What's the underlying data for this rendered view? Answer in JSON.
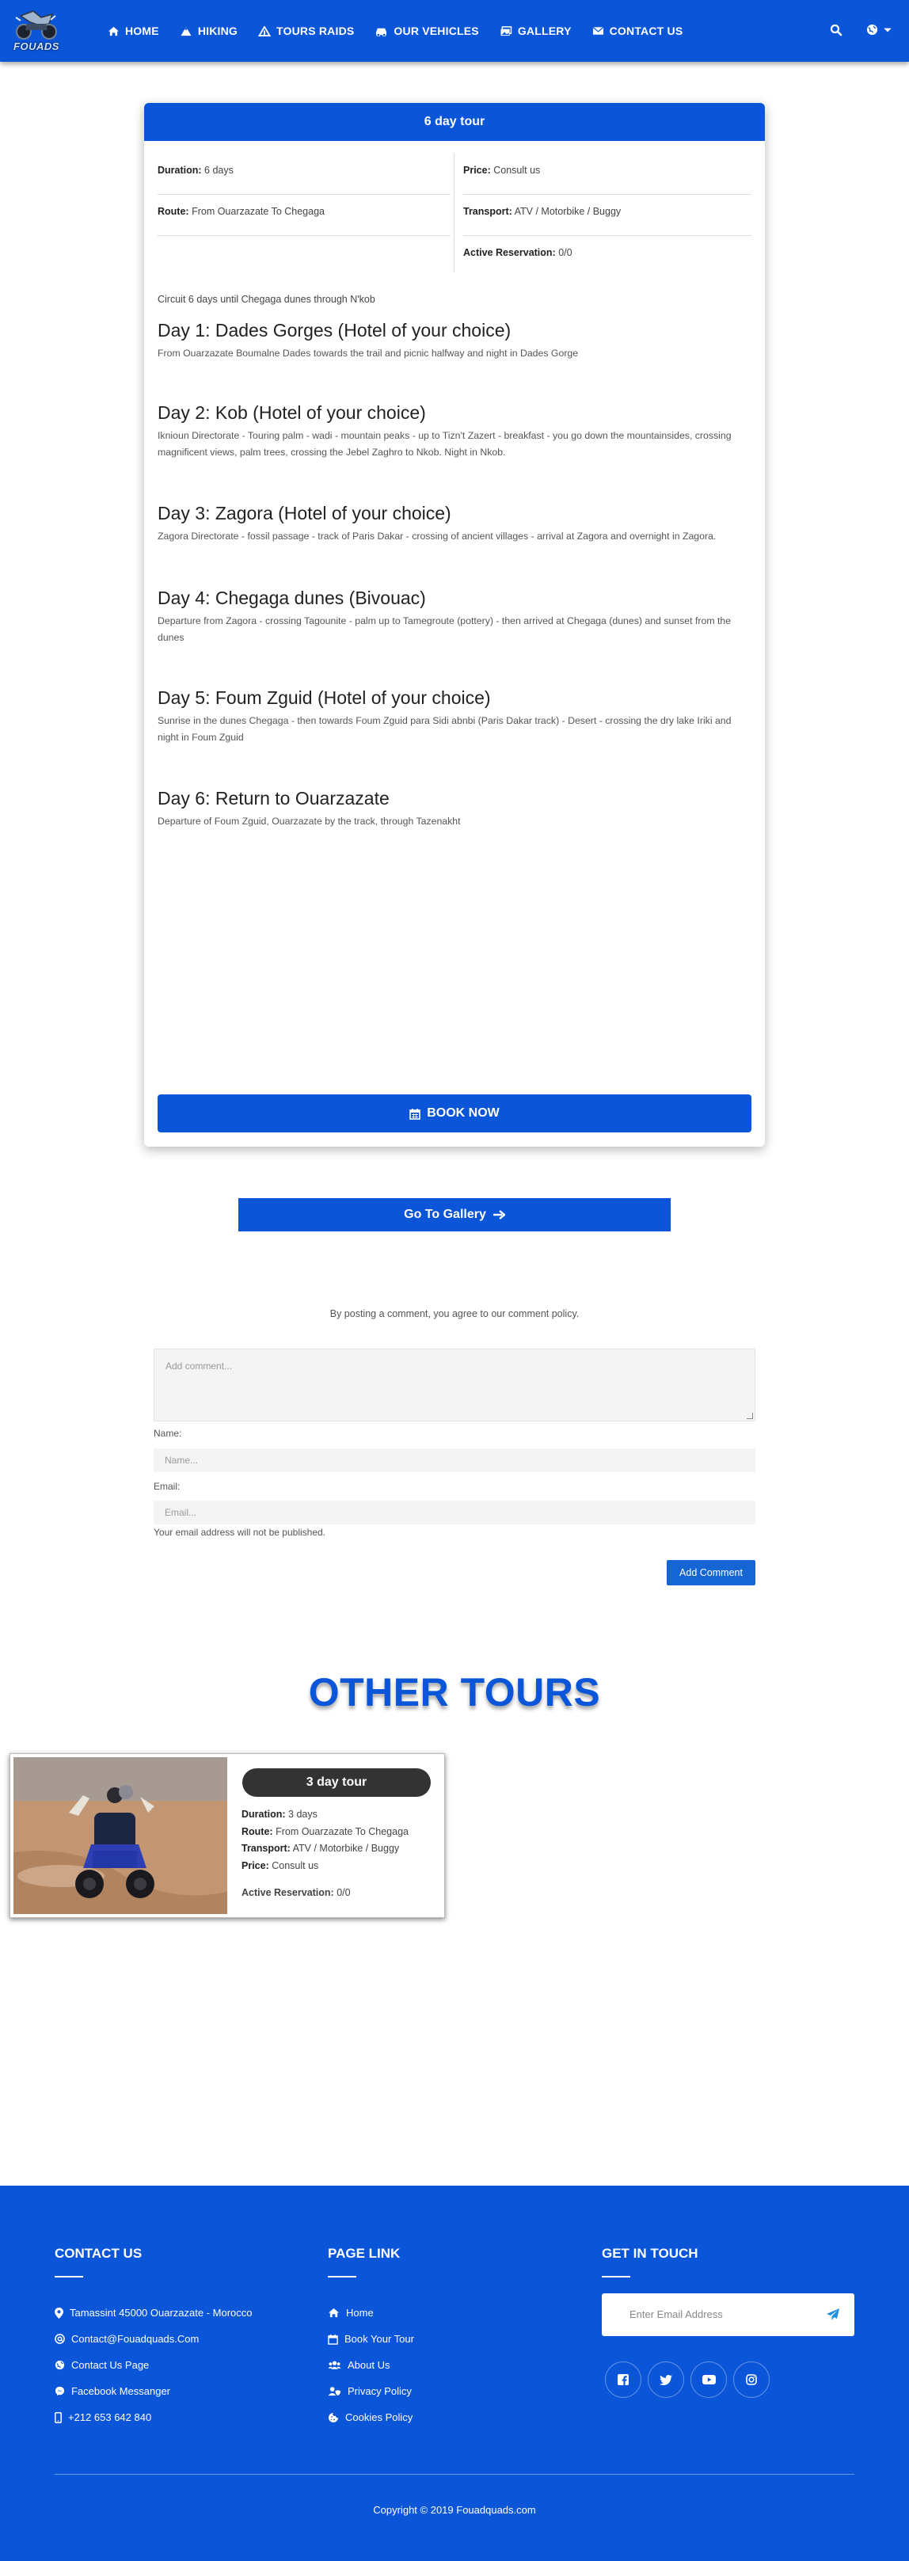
{
  "brand": {
    "logo_text": "FOUADS"
  },
  "nav": {
    "items": [
      {
        "label": "HOME",
        "icon": "home-icon"
      },
      {
        "label": "HIKING",
        "icon": "mountain-icon"
      },
      {
        "label": "TOURS RAIDS",
        "icon": "hiking-icon"
      },
      {
        "label": "OUR VEHICLES",
        "icon": "car-icon"
      },
      {
        "label": "GALLERY",
        "icon": "images-icon"
      },
      {
        "label": "CONTACT US",
        "icon": "envelope-icon"
      }
    ],
    "search_icon": "search-icon",
    "language_icon": "globe-icon"
  },
  "tour": {
    "title": "6 day tour",
    "duration_label": "Duration:",
    "duration": "6 days",
    "route_label": "Route:",
    "route": "From Ouarzazate To Chegaga",
    "price_label": "Price:",
    "price": "Consult us",
    "transport_label": "Transport:",
    "transport": "ATV / Motorbike / Buggy",
    "reservation_label": "Active Reservation:",
    "reservation": "0/0",
    "intro": "Circuit 6 days until Chegaga dunes through N'kob",
    "days": [
      {
        "title": "Day 1: Dades Gorges (Hotel of your choice)",
        "text": "From Ouarzazate Boumalne Dades towards the trail and picnic halfway and night in Dades Gorge"
      },
      {
        "title": "Day 2: Kob (Hotel of your choice)",
        "text": "Iknioun Directorate - Touring palm - wadi - mountain peaks - up to Tizn't Zazert - breakfast - you go down the mountainsides, crossing magnificent views, palm trees, crossing the Jebel Zaghro to Nkob. Night in Nkob."
      },
      {
        "title": "Day 3: Zagora (Hotel of your choice)",
        "text": "Zagora Directorate - fossil passage - track of Paris Dakar - crossing of ancient villages - arrival at Zagora and overnight in Zagora."
      },
      {
        "title": "Day 4: Chegaga dunes (Bivouac)",
        "text": "Departure from Zagora - crossing Tagounite - palm up to Tamegroute (pottery) - then arrived at Chegaga (dunes) and sunset from the dunes"
      },
      {
        "title": "Day 5: Foum Zguid (Hotel of your choice)",
        "text": "Sunrise in the dunes Chegaga - then towards Foum Zguid para Sidi abnbi (Paris Dakar track) - Desert - crossing the dry lake Iriki and night in Foum Zguid"
      },
      {
        "title": "Day 6: Return to Ouarzazate",
        "text": "Departure of Foum Zguid, Ouarzazate by the track, through Tazenakht"
      }
    ],
    "book_label": "BOOK NOW"
  },
  "gallery_button": {
    "label": "Go To Gallery"
  },
  "comments": {
    "policy": "By posting a comment, you agree to our comment policy.",
    "comment_placeholder": "Add comment...",
    "name_label": "Name:",
    "name_placeholder": "Name...",
    "email_label": "Email:",
    "email_placeholder": "Email...",
    "email_note": "Your email address will not be published.",
    "submit_label": "Add Comment"
  },
  "other_tours": {
    "title": "OTHER TOURS",
    "cards": [
      {
        "title": "3 day tour",
        "duration_label": "Duration:",
        "duration": "3 days",
        "route_label": "Route:",
        "route": "From Ouarzazate To Chegaga",
        "transport_label": "Transport:",
        "transport": "ATV / Motorbike / Buggy",
        "price_label": "Price:",
        "price": "Consult us",
        "reservation_label": "Active Reservation:",
        "reservation": "0/0"
      }
    ]
  },
  "footer": {
    "contact": {
      "title": "CONTACT US",
      "items": [
        {
          "text": "Tamassint 45000 Ouarzazate - Morocco",
          "icon": "map-marker-icon"
        },
        {
          "text": "Contact@Fouadquads.Com",
          "icon": "at-icon"
        },
        {
          "text": "Contact Us Page",
          "icon": "globe-icon"
        },
        {
          "text": "Facebook Messanger",
          "icon": "messenger-icon"
        },
        {
          "text": "+212 653 642 840",
          "icon": "mobile-icon"
        }
      ]
    },
    "links": {
      "title": "PAGE LINK",
      "items": [
        {
          "text": "Home",
          "icon": "home-icon"
        },
        {
          "text": "Book Your Tour",
          "icon": "calendar-icon"
        },
        {
          "text": "About Us",
          "icon": "users-icon"
        },
        {
          "text": "Privacy Policy",
          "icon": "user-shield-icon"
        },
        {
          "text": "Cookies Policy",
          "icon": "cookie-icon"
        }
      ]
    },
    "touch": {
      "title": "GET IN TOUCH",
      "email_placeholder": "Enter Email Address",
      "socials": [
        "facebook-icon",
        "twitter-icon",
        "youtube-icon",
        "instagram-icon"
      ]
    },
    "copyright": "Copyright © 2019 Fouadquads.com"
  },
  "colors": {
    "primary": "#0a55d8",
    "dark_badge": "#333333",
    "text": "#444444"
  }
}
